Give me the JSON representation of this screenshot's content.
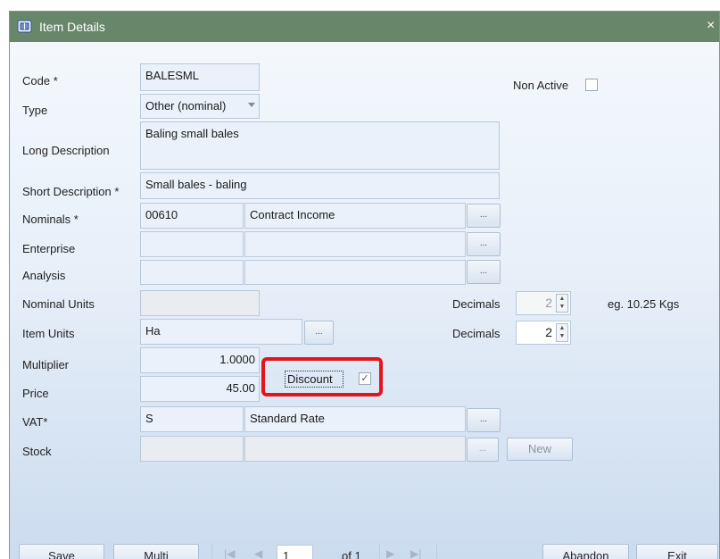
{
  "window": {
    "title": "Item Details",
    "close_glyph": "×"
  },
  "form": {
    "code": {
      "label": "Code *",
      "value": "BALESML"
    },
    "non_active": {
      "label": "Non Active",
      "checked": false
    },
    "type": {
      "label": "Type",
      "value": "Other (nominal)"
    },
    "long_description": {
      "label": "Long Description",
      "value": "Baling small bales"
    },
    "short_description": {
      "label": "Short Description *",
      "value": "Small bales - baling"
    },
    "nominals": {
      "label": "Nominals *",
      "code": "00610",
      "name": "Contract Income"
    },
    "enterprise": {
      "label": "Enterprise",
      "code": "",
      "name": ""
    },
    "analysis": {
      "label": "Analysis",
      "code": "",
      "name": ""
    },
    "nominal_units": {
      "label": "Nominal Units",
      "value": "",
      "decimals_label": "Decimals",
      "decimals": "2",
      "example": "eg. 10.25 Kgs"
    },
    "item_units": {
      "label": "Item Units",
      "value": "Ha",
      "decimals_label": "Decimals",
      "decimals": "2"
    },
    "multiplier": {
      "label": "Multiplier",
      "value": "1.0000"
    },
    "price": {
      "label": "Price",
      "value": "45.00"
    },
    "discount": {
      "label": "Discount",
      "checked": true
    },
    "vat": {
      "label": "VAT*",
      "code": "S",
      "name": "Standard Rate"
    },
    "stock": {
      "label": "Stock",
      "code": "",
      "name": "",
      "new_label": "New"
    },
    "ellipsis": "..."
  },
  "toolbar": {
    "save_label": "Save",
    "multi_label": "Multi",
    "page_value": "1",
    "page_of": "of 1",
    "abandon_label": "Abandon",
    "exit_label": "Exit"
  },
  "colors": {
    "titlebar": "#68876a",
    "highlight": "#e3141c",
    "client_bg": "#d6e5f5"
  },
  "icons": {
    "app": "package-icon",
    "nav_first": "first-page-icon",
    "nav_prev": "prev-page-icon",
    "nav_next": "next-page-icon",
    "nav_last": "last-page-icon"
  }
}
